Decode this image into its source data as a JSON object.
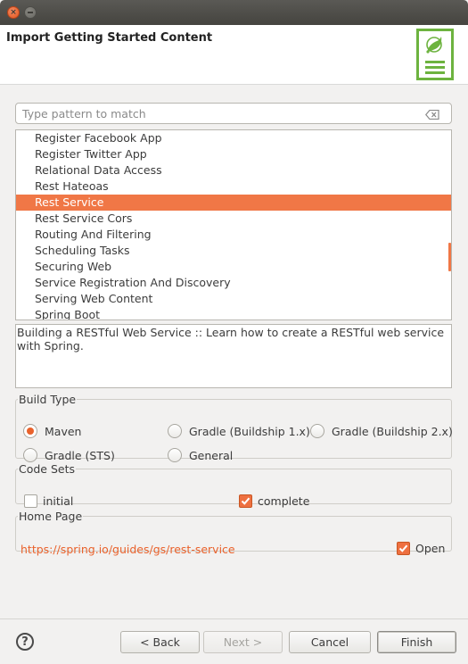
{
  "window": {
    "close_glyph": "×"
  },
  "header": {
    "title": "Import Getting Started Content",
    "logo_icon": "spring-guide-icon",
    "logo_color": "#6db33f"
  },
  "search": {
    "placeholder": "Type pattern to match",
    "value": ""
  },
  "guides": {
    "items": [
      "Register Facebook App",
      "Register Twitter App",
      "Relational Data Access",
      "Rest Hateoas",
      "Rest Service",
      "Rest Service Cors",
      "Routing And Filtering",
      "Scheduling Tasks",
      "Securing Web",
      "Service Registration And Discovery",
      "Serving Web Content",
      "Spring Boot"
    ],
    "selected": "Rest Service",
    "selection_color": "#f07746"
  },
  "description": "Building a RESTful Web Service :: Learn how to create a RESTful web service with Spring.",
  "build_type": {
    "legend": "Build Type",
    "options": [
      "Maven",
      "Gradle (Buildship 1.x)",
      "Gradle (Buildship 2.x)",
      "Gradle (STS)",
      "General"
    ],
    "selected": "Maven"
  },
  "code_sets": {
    "legend": "Code Sets",
    "initial": {
      "label": "initial",
      "checked": false
    },
    "complete": {
      "label": "complete",
      "checked": true
    }
  },
  "home_page": {
    "legend": "Home Page",
    "url": "https://spring.io/guides/gs/rest-service",
    "open": {
      "label": "Open",
      "checked": true
    }
  },
  "footer": {
    "help_label": "?",
    "back_label": "< Back",
    "next_label": "Next >",
    "cancel_label": "Cancel",
    "finish_label": "Finish"
  },
  "accent_color": "#e9622c"
}
